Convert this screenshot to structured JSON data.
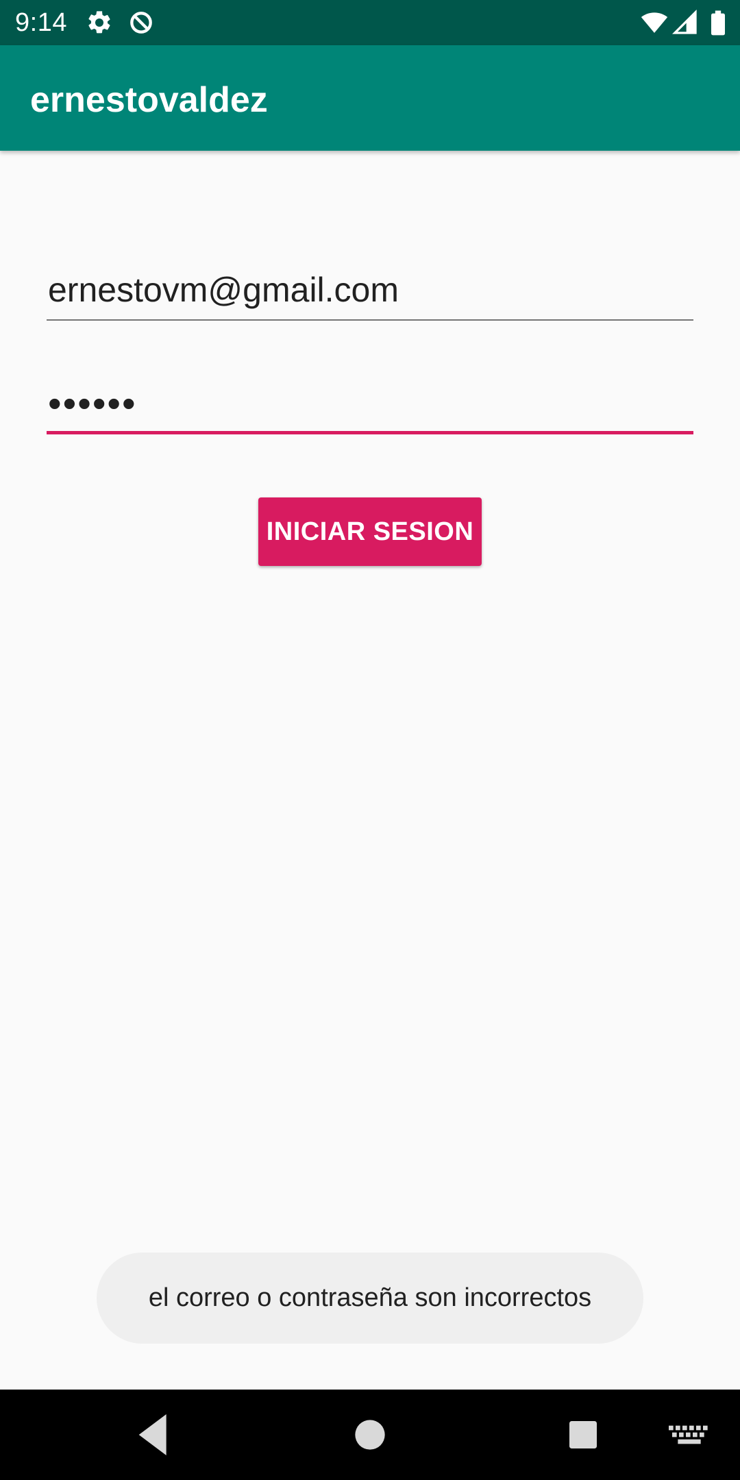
{
  "status_bar": {
    "time": "9:14",
    "icons": [
      "gear-icon",
      "data-saver-icon",
      "wifi-icon",
      "signal-icon",
      "battery-icon"
    ]
  },
  "app_bar": {
    "title": "ernestovaldez"
  },
  "form": {
    "email_value": "ernestovm@gmail.com",
    "password_value": "••••••",
    "login_label": "INICIAR SESION"
  },
  "toast": {
    "message": "el correo o contraseña son incorrectos"
  },
  "nav_bar": {
    "icons": [
      "back-icon",
      "home-icon",
      "recents-icon",
      "keyboard-icon"
    ]
  },
  "colors": {
    "status_bar": "#00574b",
    "app_bar": "#008577",
    "accent": "#d81b60",
    "background": "#fafafa",
    "toast_background": "#efefef"
  }
}
